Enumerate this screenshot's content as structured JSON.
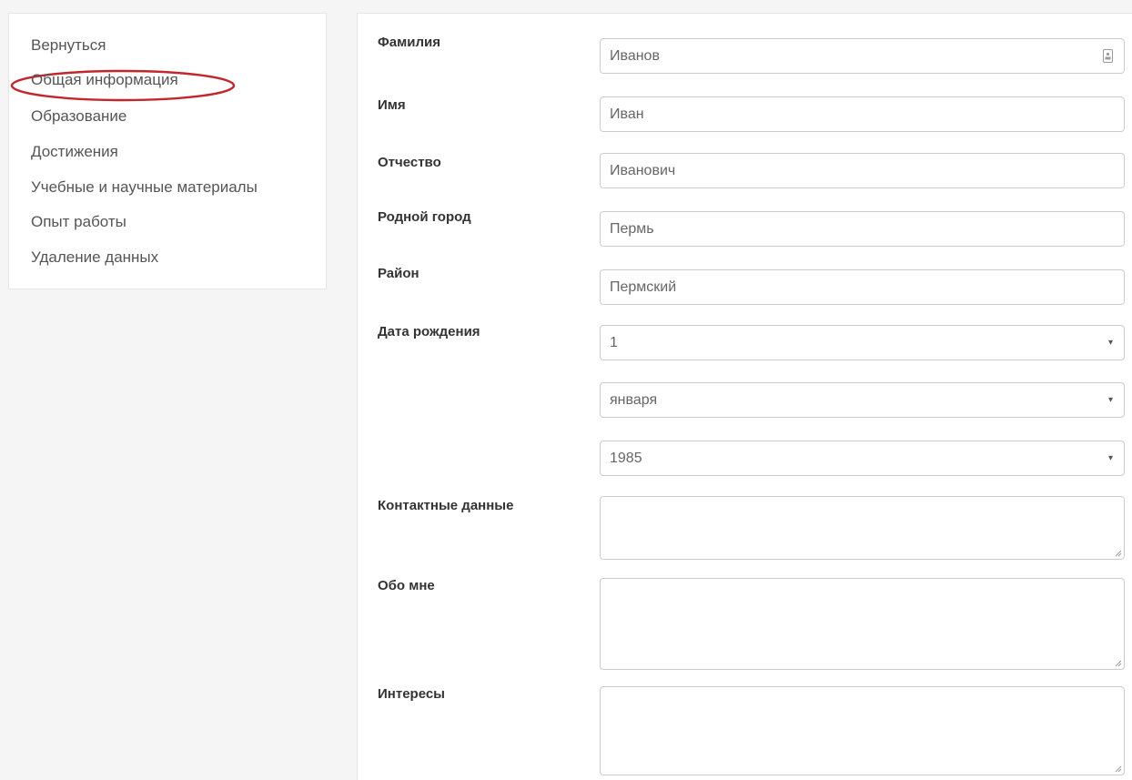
{
  "sidebar": {
    "items": [
      {
        "label": "Вернуться"
      },
      {
        "label": "Общая информация"
      },
      {
        "label": "Образование"
      },
      {
        "label": "Достижения"
      },
      {
        "label": "Учебные и научные материалы"
      },
      {
        "label": "Опыт работы"
      },
      {
        "label": "Удаление данных"
      }
    ],
    "highlight_color": "#c0282d"
  },
  "form": {
    "last_name": {
      "label": "Фамилия",
      "value": "Иванов"
    },
    "first_name": {
      "label": "Имя",
      "value": "Иван"
    },
    "patronymic": {
      "label": "Отчество",
      "value": "Иванович"
    },
    "home_city": {
      "label": "Родной город",
      "value": "Пермь"
    },
    "district": {
      "label": "Район",
      "value": "Пермский"
    },
    "birth_date": {
      "label": "Дата рождения",
      "day": "1",
      "month": "января",
      "year": "1985"
    },
    "contacts": {
      "label": "Контактные данные",
      "value": ""
    },
    "about": {
      "label": "Обо мне",
      "value": ""
    },
    "interests": {
      "label": "Интересы",
      "value": ""
    }
  },
  "icons": {
    "select_arrow": "▾",
    "autofill": "contact-card-icon",
    "resize": "resize-grip-icon"
  }
}
